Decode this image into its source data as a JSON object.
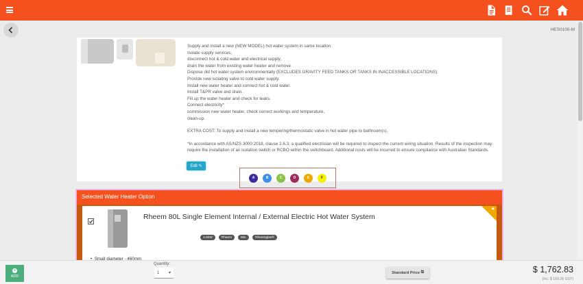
{
  "header": {
    "icons": [
      "menu-icon",
      "document-icon",
      "book-icon",
      "search-icon",
      "edit-icon",
      "home-icon"
    ]
  },
  "page_code": "HES0100-M",
  "description": {
    "lines": [
      "Supply and install a new (NEW MODEL) hot water system in same location.",
      "Isolate supply services,",
      "disconnect hot & cold water and electrical supply,",
      "drain the water from existing water heater and remove",
      "Dispose old hot water system environmentally (EXCLUDES GRAVITY FEED TANKS OR TANKS IN INACCESSIBLE LOCATIONS).",
      "Provide new isolating valve to cold water supply.",
      "Install new water heater and connect hot & cold water.",
      "Install T&PR valve and drain.",
      "Fill up the water heater and check for leaks.",
      "Connect electricity*",
      "commission new water heater, check correct workings and temperature,",
      "clean-up."
    ],
    "extra_cost": "EXTRA COST: To supply and install a new tempering/thermostatic valve in hot water pipe to bathroom(s).",
    "note": "*In accordance with AS/NZS 3000:2018, clause 2.6.3, a qualified electrician will be required to inspect the current wiring situation. Results of the inspection may require the installation of an isolation switch or RCBO within the switchboard. Additional costs will be incurred to ensure compliance with Australian Standards."
  },
  "edit_label": "Edit",
  "options": [
    {
      "label": "A",
      "color": "#3d2a9c",
      "text_color": "#ffffff"
    },
    {
      "label": "B",
      "color": "#3f8fe8",
      "text_color": "#ffffff"
    },
    {
      "label": "C",
      "color": "#8bc34a",
      "text_color": "#ffffff"
    },
    {
      "label": "D",
      "color": "#9c2b5a",
      "text_color": "#ffffff"
    },
    {
      "label": "E",
      "color": "#f0a800",
      "text_color": "#ffffff"
    },
    {
      "label": "F",
      "color": "#f2f200",
      "text_color": "#333333"
    }
  ],
  "selected": {
    "header": "Selected Water Heater Option",
    "product_title": "Rheem 80L Single Element Internal / External Electric Hot Water System",
    "tags": [
      "3.6kW",
      "Rheem",
      "80L",
      "Rheemglas®"
    ],
    "bullet": "Small diameter - 460mm"
  },
  "footer": {
    "add_label": "ADD",
    "quantity_label": "Quantity:",
    "quantity_value": "1",
    "standard_price_label": "Standard Price",
    "price": "$ 1,762.83",
    "gst": "(Inc. $ 160.26 GST)"
  },
  "colors": {
    "accent": "#f4511e",
    "selected_border": "#c55a0f",
    "edit": "#26a7c9",
    "add": "#4caf7b"
  }
}
